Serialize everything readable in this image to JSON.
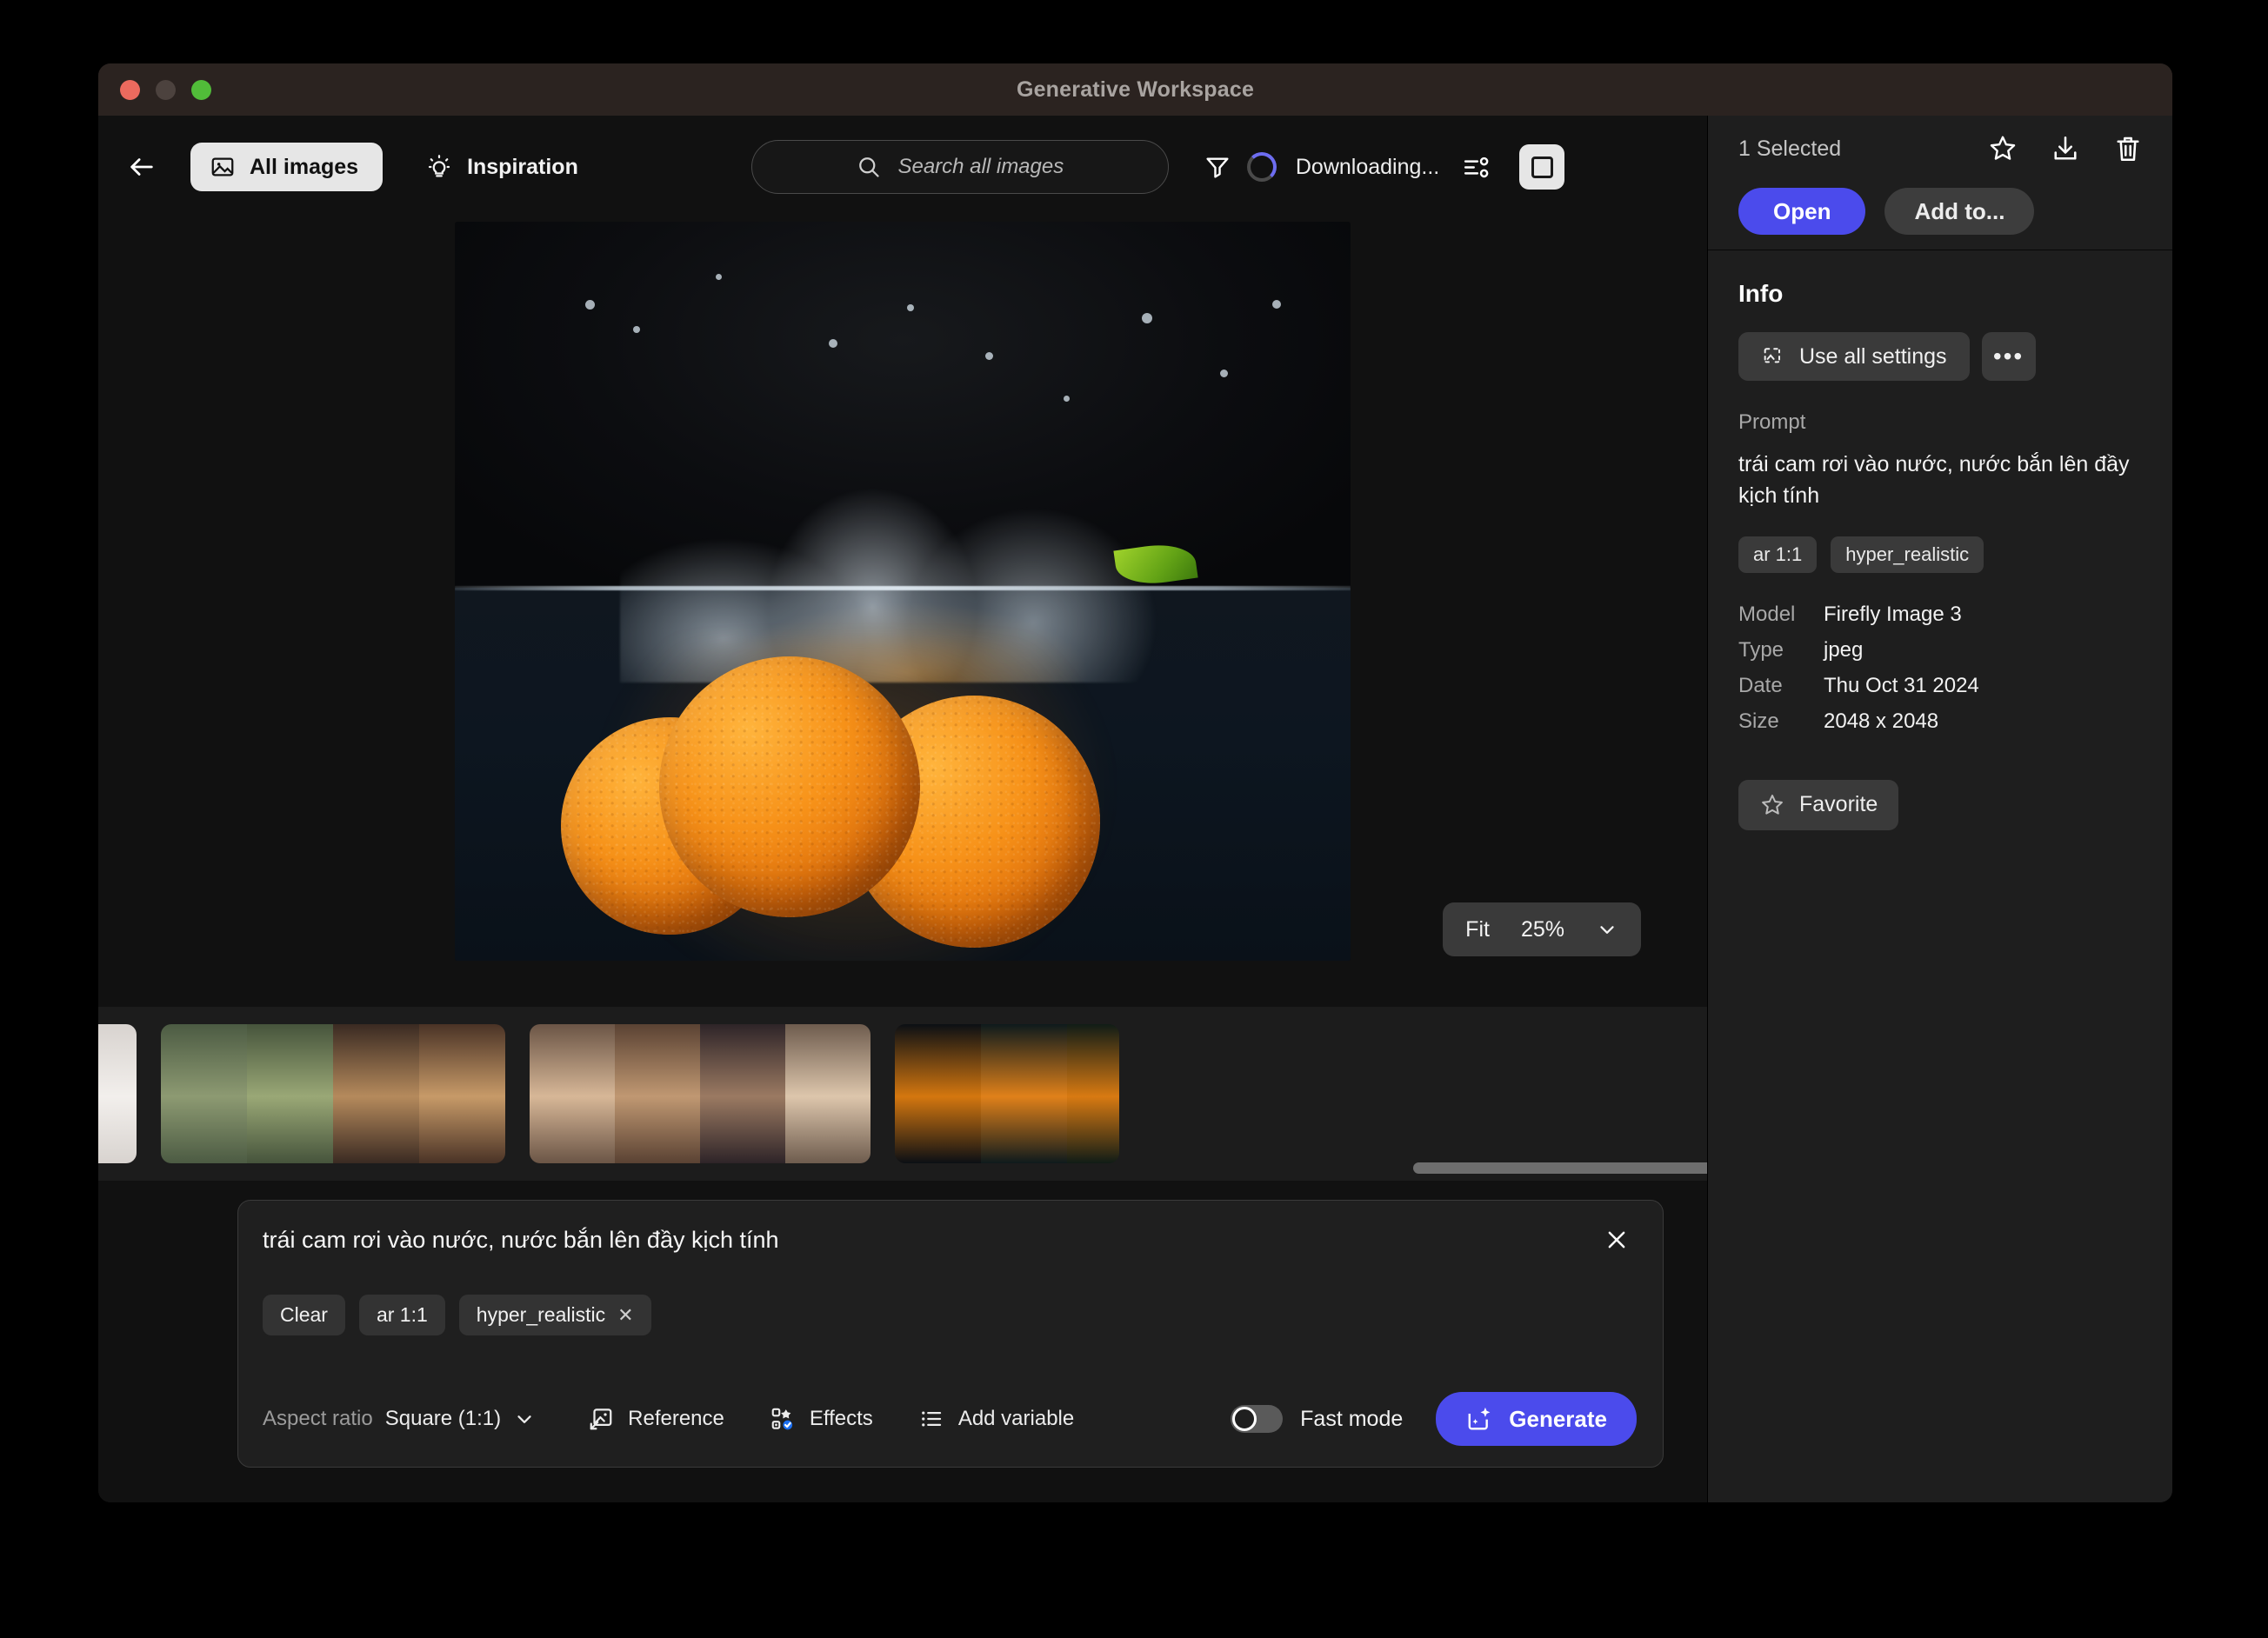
{
  "window": {
    "title": "Generative Workspace"
  },
  "toolbar": {
    "back_label": "Back",
    "all_images_label": "All images",
    "inspiration_label": "Inspiration",
    "search_placeholder": "Search all images",
    "status": "Downloading...",
    "filter_label": "Filter",
    "sort_label": "Sort",
    "view_label": "View"
  },
  "canvas": {
    "fit_label": "Fit",
    "zoom_level": "25%"
  },
  "prompt_bar": {
    "text": "trái cam rơi vào nước, nước bắn lên đầy kịch tính",
    "close_label": "✕",
    "chips": [
      {
        "label": "Clear",
        "removable": false
      },
      {
        "label": "ar 1:1",
        "removable": false
      },
      {
        "label": "hyper_realistic",
        "removable": true,
        "remove_glyph": "✕"
      }
    ],
    "aspect_ratio_label": "Aspect ratio",
    "aspect_ratio_value": "Square (1:1)",
    "reference_label": "Reference",
    "effects_label": "Effects",
    "add_variable_label": "Add variable",
    "fast_mode_label": "Fast mode",
    "fast_mode_on": false,
    "generate_label": "Generate"
  },
  "right_panel": {
    "selected_count": "1 Selected",
    "favorite_icon_label": "Favorite",
    "download_icon_label": "Download",
    "delete_icon_label": "Delete",
    "open_label": "Open",
    "add_to_label": "Add to...",
    "info_title": "Info",
    "use_all_settings_label": "Use all settings",
    "more_label": "•••",
    "prompt_label": "Prompt",
    "prompt_value": "trái cam rơi vào nước, nước bắn lên đầy kịch tính",
    "tags": [
      "ar 1:1",
      "hyper_realistic"
    ],
    "meta": [
      {
        "key": "Model",
        "value": "Firefly Image 3"
      },
      {
        "key": "Type",
        "value": "jpeg"
      },
      {
        "key": "Date",
        "value": "Thu Oct 31 2024"
      },
      {
        "key": "Size",
        "value": "2048 x 2048"
      }
    ],
    "favorite_button_label": "Favorite"
  },
  "filmstrip": {
    "groups": [
      {
        "thumbs": [
          {
            "name": "portrait-woman",
            "w": 84,
            "c1": "#d8d3cf",
            "c2": "#f2efec"
          }
        ]
      },
      {
        "thumbs": [
          {
            "name": "green-skincare-set",
            "w": 99,
            "c1": "#4c5b43",
            "c2": "#8d9a72"
          },
          {
            "name": "green-plants-cosmetics",
            "w": 99,
            "c1": "#46543c",
            "c2": "#9aa876"
          },
          {
            "name": "golden-bokeh-cosmetics",
            "w": 99,
            "c1": "#3a2a22",
            "c2": "#b58a5c"
          },
          {
            "name": "makeup-brush-set",
            "w": 99,
            "c1": "#4a3326",
            "c2": "#c79a68"
          }
        ]
      },
      {
        "thumbs": [
          {
            "name": "beige-cosmetics-table",
            "w": 98,
            "c1": "#6b5546",
            "c2": "#d7b797"
          },
          {
            "name": "warm-bottles-shelf",
            "w": 98,
            "c1": "#5a4233",
            "c2": "#c09872"
          },
          {
            "name": "eyeshadow-palette",
            "w": 98,
            "c1": "#2e2428",
            "c2": "#9b7a62"
          },
          {
            "name": "lipstick-flatlay",
            "w": 98,
            "c1": "#6e5c4e",
            "c2": "#ddc6ac"
          }
        ]
      },
      {
        "thumbs": [
          {
            "name": "orange-splash-dark",
            "w": 99,
            "c1": "#0b0f14",
            "c2": "#d4770f"
          },
          {
            "name": "orange-splash-teal",
            "w": 99,
            "c1": "#0e1a1c",
            "c2": "#e0811a"
          },
          {
            "name": "orange-splash-green",
            "w": 60,
            "c1": "#101c16",
            "c2": "#d87a12"
          }
        ]
      }
    ]
  },
  "colors": {
    "accent": "#4b4bec",
    "titlebar": "#2b2320",
    "panel": "#1e1e1e",
    "canvas_bg": "#111111"
  }
}
